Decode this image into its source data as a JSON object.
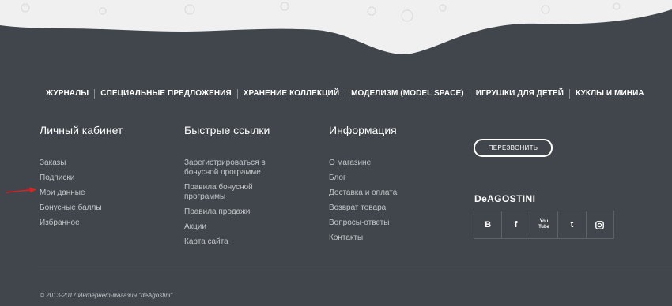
{
  "nav": {
    "items": [
      "ЖУРНАЛЫ",
      "СПЕЦИАЛЬНЫЕ ПРЕДЛОЖЕНИЯ",
      "ХРАНЕНИЕ КОЛЛЕКЦИЙ",
      "МОДЕЛИЗМ (MODEL SPACE)",
      "ИГРУШКИ ДЛЯ ДЕТЕЙ",
      "КУКЛЫ И МИНИА"
    ]
  },
  "account": {
    "title": "Личный кабинет",
    "links": [
      "Заказы",
      "Подписки",
      "Мои данные",
      "Бонусные баллы",
      "Избранное"
    ]
  },
  "quick": {
    "title": "Быстрые ссылки",
    "links": [
      "Зарегистрироваться в бонусной программе",
      "Правила бонусной программы",
      "Правила продажи",
      "Акции",
      "Карта сайта"
    ]
  },
  "info": {
    "title": "Информация",
    "links": [
      "О магазине",
      "Блог",
      "Доставка и оплата",
      "Возврат товара",
      "Вопросы-ответы",
      "Контакты"
    ]
  },
  "callback_label": "ПЕРЕЗВОНИТЬ",
  "brand": "DeAGOSTINI",
  "social": [
    "В",
    "f",
    "You Tube",
    "t",
    "instagram-icon"
  ],
  "copyright": "© 2013-2017 Интернет-магазин \"deAgostini\"",
  "colors": {
    "bg": "#40464b",
    "wave": "#f0f0f0",
    "arrow": "#e02020"
  }
}
